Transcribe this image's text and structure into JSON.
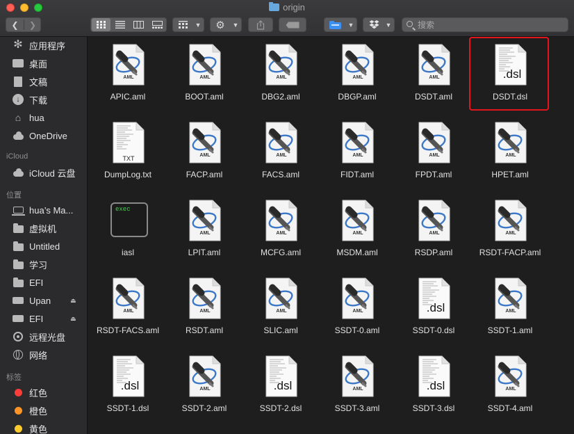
{
  "window": {
    "title": "origin"
  },
  "toolbar": {
    "search_placeholder": "搜索",
    "view_modes": [
      "icon-view",
      "list-view",
      "column-view",
      "gallery-view"
    ],
    "selected_view": "icon-view"
  },
  "sidebar": {
    "favorites": [
      {
        "label": "应用程序",
        "icon": "applications-icon"
      },
      {
        "label": "桌面",
        "icon": "desktop-icon"
      },
      {
        "label": "文稿",
        "icon": "documents-icon"
      },
      {
        "label": "下载",
        "icon": "downloads-icon"
      },
      {
        "label": "hua",
        "icon": "home-icon"
      },
      {
        "label": "OneDrive",
        "icon": "cloud-icon"
      }
    ],
    "icloud_header": "iCloud",
    "icloud": [
      {
        "label": "iCloud 云盘",
        "icon": "icloud-icon"
      }
    ],
    "locations_header": "位置",
    "locations": [
      {
        "label": "hua’s Ma...",
        "icon": "laptop-icon",
        "eject": false
      },
      {
        "label": "虚拟机",
        "icon": "folder-icon",
        "eject": false
      },
      {
        "label": "Untitled",
        "icon": "folder-icon",
        "eject": false
      },
      {
        "label": "学习",
        "icon": "folder-icon",
        "eject": false
      },
      {
        "label": "EFI",
        "icon": "folder-icon",
        "eject": false
      },
      {
        "label": "Upan",
        "icon": "disk-icon",
        "eject": true
      },
      {
        "label": "EFI",
        "icon": "disk-icon",
        "eject": true
      },
      {
        "label": "远程光盘",
        "icon": "optical-disc-icon",
        "eject": false
      },
      {
        "label": "网络",
        "icon": "network-icon",
        "eject": false
      }
    ],
    "tags_header": "标签",
    "tags": [
      {
        "label": "红色",
        "color": "#fc3d39"
      },
      {
        "label": "橙色",
        "color": "#fd9426"
      },
      {
        "label": "黄色",
        "color": "#fecb2e"
      }
    ]
  },
  "files": [
    {
      "name": "APIC.aml",
      "type": "aml"
    },
    {
      "name": "BOOT.aml",
      "type": "aml"
    },
    {
      "name": "DBG2.aml",
      "type": "aml"
    },
    {
      "name": "DBGP.aml",
      "type": "aml"
    },
    {
      "name": "DSDT.aml",
      "type": "aml"
    },
    {
      "name": "DSDT.dsl",
      "type": "dsl",
      "highlighted": true
    },
    {
      "name": "DumpLog.txt",
      "type": "txt"
    },
    {
      "name": "FACP.aml",
      "type": "aml"
    },
    {
      "name": "FACS.aml",
      "type": "aml"
    },
    {
      "name": "FIDT.aml",
      "type": "aml"
    },
    {
      "name": "FPDT.aml",
      "type": "aml"
    },
    {
      "name": "HPET.aml",
      "type": "aml"
    },
    {
      "name": "iasl",
      "type": "exec"
    },
    {
      "name": "LPIT.aml",
      "type": "aml"
    },
    {
      "name": "MCFG.aml",
      "type": "aml"
    },
    {
      "name": "MSDM.aml",
      "type": "aml"
    },
    {
      "name": "RSDP.aml",
      "type": "aml"
    },
    {
      "name": "RSDT-FACP.aml",
      "type": "aml"
    },
    {
      "name": "RSDT-FACS.aml",
      "type": "aml"
    },
    {
      "name": "RSDT.aml",
      "type": "aml"
    },
    {
      "name": "SLIC.aml",
      "type": "aml"
    },
    {
      "name": "SSDT-0.aml",
      "type": "aml"
    },
    {
      "name": "SSDT-0.dsl",
      "type": "dsl"
    },
    {
      "name": "SSDT-1.aml",
      "type": "aml"
    },
    {
      "name": "SSDT-1.dsl",
      "type": "dsl"
    },
    {
      "name": "SSDT-2.aml",
      "type": "aml"
    },
    {
      "name": "SSDT-2.dsl",
      "type": "dsl"
    },
    {
      "name": "SSDT-3.aml",
      "type": "aml"
    },
    {
      "name": "SSDT-3.dsl",
      "type": "dsl"
    },
    {
      "name": "SSDT-4.aml",
      "type": "aml"
    }
  ],
  "icon_text": {
    "aml": "AML",
    "dsl": ".dsl",
    "txt": "TXT",
    "exec": "exec"
  },
  "colors": {
    "highlight": "#e3151c",
    "tag_red": "#fc3d39",
    "tag_orange": "#fd9426",
    "tag_yellow": "#fecb2e"
  }
}
